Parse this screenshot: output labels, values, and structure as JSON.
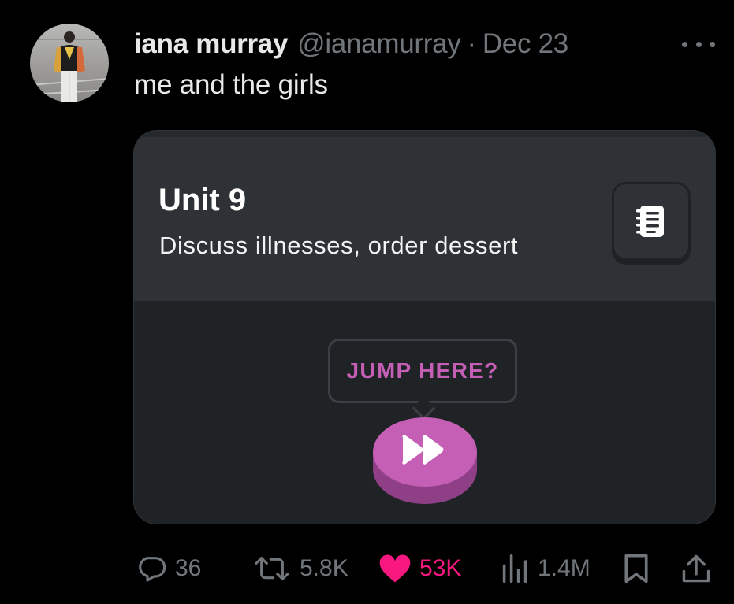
{
  "tweet": {
    "author_name": "iana murray",
    "author_handle": "@ianamurray",
    "separator": "·",
    "date": "Dec 23",
    "text": "me and the girls"
  },
  "media": {
    "unit_title": "Unit 9",
    "unit_subtitle": "Discuss illnesses, order dessert",
    "jump_prompt": "JUMP HERE?",
    "icons": [
      "notebook-icon",
      "fast-forward-icon"
    ],
    "colors": {
      "accent_pink": "#c55fb6",
      "panel": "#2e3135",
      "background": "#202326"
    }
  },
  "actions": {
    "replies": "36",
    "reposts": "5.8K",
    "likes": "53K",
    "views": "1.4M",
    "icons": [
      "reply-icon",
      "repost-icon",
      "heart-icon",
      "views-icon",
      "bookmark-icon",
      "share-icon"
    ],
    "like_color": "#f91880"
  }
}
